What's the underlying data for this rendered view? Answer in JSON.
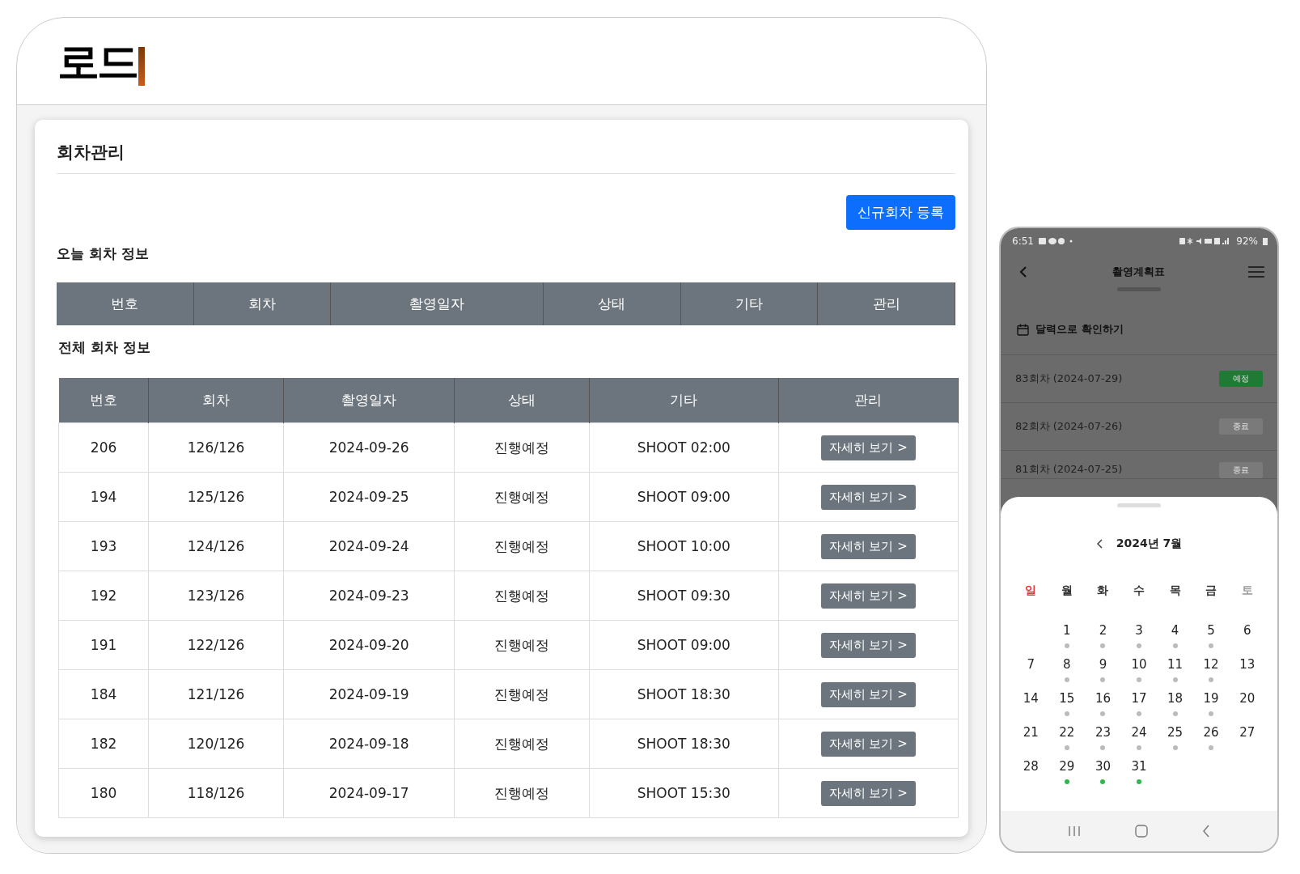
{
  "logo": {
    "text": "로드"
  },
  "page": {
    "title": "회차관리",
    "new_button": "신규회차 등록"
  },
  "today": {
    "title": "오늘 회차 정보",
    "columns": [
      "번호",
      "회차",
      "촬영일자",
      "상태",
      "기타",
      "관리"
    ]
  },
  "all": {
    "title": "전체 회차 정보",
    "columns": [
      "번호",
      "회차",
      "촬영일자",
      "상태",
      "기타",
      "관리"
    ],
    "rows": [
      {
        "no": "206",
        "round": "126/126",
        "date": "2024-09-26",
        "status": "진행예정",
        "note": "SHOOT 02:00",
        "action": "자세히 보기 >"
      },
      {
        "no": "194",
        "round": "125/126",
        "date": "2024-09-25",
        "status": "진행예정",
        "note": "SHOOT 09:00",
        "action": "자세히 보기 >"
      },
      {
        "no": "193",
        "round": "124/126",
        "date": "2024-09-24",
        "status": "진행예정",
        "note": "SHOOT 10:00",
        "action": "자세히 보기 >"
      },
      {
        "no": "192",
        "round": "123/126",
        "date": "2024-09-23",
        "status": "진행예정",
        "note": "SHOOT 09:30",
        "action": "자세히 보기 >"
      },
      {
        "no": "191",
        "round": "122/126",
        "date": "2024-09-20",
        "status": "진행예정",
        "note": "SHOOT 09:00",
        "action": "자세히 보기 >"
      },
      {
        "no": "184",
        "round": "121/126",
        "date": "2024-09-19",
        "status": "진행예정",
        "note": "SHOOT 18:30",
        "action": "자세히 보기 >"
      },
      {
        "no": "182",
        "round": "120/126",
        "date": "2024-09-18",
        "status": "진행예정",
        "note": "SHOOT 18:30",
        "action": "자세히 보기 >"
      },
      {
        "no": "180",
        "round": "118/126",
        "date": "2024-09-17",
        "status": "진행예정",
        "note": "SHOOT 15:30",
        "action": "자세히 보기 >"
      }
    ]
  },
  "phone": {
    "status_bar": {
      "time": "6:51",
      "battery": "92%"
    },
    "title": "촬영계획표",
    "calendar_link": "달력으로 확인하기",
    "sessions": [
      {
        "label": "83회차 (2024-07-29)",
        "badge": "예정",
        "color": "#1f7a34"
      },
      {
        "label": "82회차 (2024-07-26)",
        "badge": "종료",
        "color": "#7a7a7a"
      },
      {
        "label": "81회차 (2024-07-25)",
        "badge": "종료",
        "color": "#7a7a7a"
      }
    ],
    "calendar": {
      "month": "2024년 7월",
      "weekdays": [
        {
          "label": "일",
          "color": "#e53935"
        },
        {
          "label": "월",
          "color": "#333333"
        },
        {
          "label": "화",
          "color": "#333333"
        },
        {
          "label": "수",
          "color": "#333333"
        },
        {
          "label": "목",
          "color": "#333333"
        },
        {
          "label": "금",
          "color": "#333333"
        },
        {
          "label": "토",
          "color": "#999999"
        }
      ],
      "days": [
        {
          "day": "1",
          "color": "#bbbbbb"
        },
        {
          "day": "2",
          "color": "#bbbbbb"
        },
        {
          "day": "3",
          "color": "#bbbbbb"
        },
        {
          "day": "4",
          "color": "#bbbbbb"
        },
        {
          "day": "5",
          "color": "#bbbbbb"
        },
        {
          "day": "6"
        },
        {
          "day": "7"
        },
        {
          "day": "8",
          "color": "#bbbbbb"
        },
        {
          "day": "9",
          "color": "#bbbbbb"
        },
        {
          "day": "10",
          "color": "#bbbbbb"
        },
        {
          "day": "11",
          "color": "#bbbbbb"
        },
        {
          "day": "12",
          "color": "#bbbbbb"
        },
        {
          "day": "13"
        },
        {
          "day": "14"
        },
        {
          "day": "15",
          "color": "#bbbbbb"
        },
        {
          "day": "16",
          "color": "#bbbbbb"
        },
        {
          "day": "17",
          "color": "#bbbbbb"
        },
        {
          "day": "18",
          "color": "#bbbbbb"
        },
        {
          "day": "19",
          "color": "#bbbbbb"
        },
        {
          "day": "20"
        },
        {
          "day": "21"
        },
        {
          "day": "22",
          "color": "#bbbbbb"
        },
        {
          "day": "23",
          "color": "#bbbbbb"
        },
        {
          "day": "24",
          "color": "#bbbbbb"
        },
        {
          "day": "25",
          "color": "#bbbbbb"
        },
        {
          "day": "26",
          "color": "#bbbbbb"
        },
        {
          "day": "27"
        },
        {
          "day": "28"
        },
        {
          "day": "29",
          "color": "#2db84d"
        },
        {
          "day": "30",
          "color": "#2db84d"
        },
        {
          "day": "31",
          "color": "#2db84d"
        }
      ]
    }
  }
}
